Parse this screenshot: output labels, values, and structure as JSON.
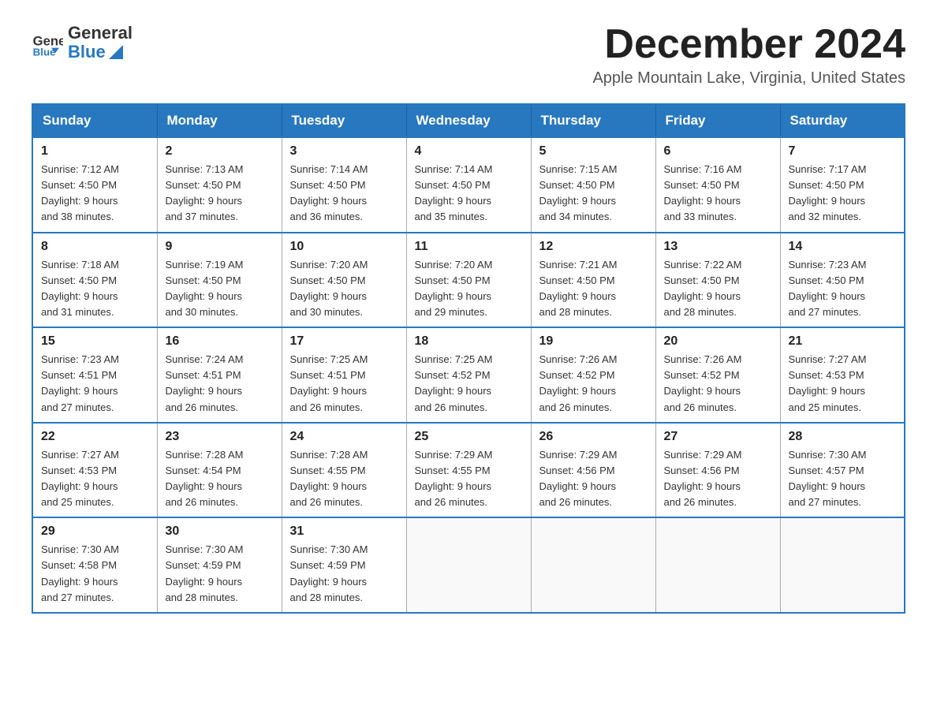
{
  "header": {
    "logo_text_general": "General",
    "logo_text_blue": "Blue",
    "month_title": "December 2024",
    "location": "Apple Mountain Lake, Virginia, United States"
  },
  "days_of_week": [
    "Sunday",
    "Monday",
    "Tuesday",
    "Wednesday",
    "Thursday",
    "Friday",
    "Saturday"
  ],
  "weeks": [
    [
      {
        "day": "1",
        "sunrise": "7:12 AM",
        "sunset": "4:50 PM",
        "daylight": "9 hours and 38 minutes."
      },
      {
        "day": "2",
        "sunrise": "7:13 AM",
        "sunset": "4:50 PM",
        "daylight": "9 hours and 37 minutes."
      },
      {
        "day": "3",
        "sunrise": "7:14 AM",
        "sunset": "4:50 PM",
        "daylight": "9 hours and 36 minutes."
      },
      {
        "day": "4",
        "sunrise": "7:14 AM",
        "sunset": "4:50 PM",
        "daylight": "9 hours and 35 minutes."
      },
      {
        "day": "5",
        "sunrise": "7:15 AM",
        "sunset": "4:50 PM",
        "daylight": "9 hours and 34 minutes."
      },
      {
        "day": "6",
        "sunrise": "7:16 AM",
        "sunset": "4:50 PM",
        "daylight": "9 hours and 33 minutes."
      },
      {
        "day": "7",
        "sunrise": "7:17 AM",
        "sunset": "4:50 PM",
        "daylight": "9 hours and 32 minutes."
      }
    ],
    [
      {
        "day": "8",
        "sunrise": "7:18 AM",
        "sunset": "4:50 PM",
        "daylight": "9 hours and 31 minutes."
      },
      {
        "day": "9",
        "sunrise": "7:19 AM",
        "sunset": "4:50 PM",
        "daylight": "9 hours and 30 minutes."
      },
      {
        "day": "10",
        "sunrise": "7:20 AM",
        "sunset": "4:50 PM",
        "daylight": "9 hours and 30 minutes."
      },
      {
        "day": "11",
        "sunrise": "7:20 AM",
        "sunset": "4:50 PM",
        "daylight": "9 hours and 29 minutes."
      },
      {
        "day": "12",
        "sunrise": "7:21 AM",
        "sunset": "4:50 PM",
        "daylight": "9 hours and 28 minutes."
      },
      {
        "day": "13",
        "sunrise": "7:22 AM",
        "sunset": "4:50 PM",
        "daylight": "9 hours and 28 minutes."
      },
      {
        "day": "14",
        "sunrise": "7:23 AM",
        "sunset": "4:50 PM",
        "daylight": "9 hours and 27 minutes."
      }
    ],
    [
      {
        "day": "15",
        "sunrise": "7:23 AM",
        "sunset": "4:51 PM",
        "daylight": "9 hours and 27 minutes."
      },
      {
        "day": "16",
        "sunrise": "7:24 AM",
        "sunset": "4:51 PM",
        "daylight": "9 hours and 26 minutes."
      },
      {
        "day": "17",
        "sunrise": "7:25 AM",
        "sunset": "4:51 PM",
        "daylight": "9 hours and 26 minutes."
      },
      {
        "day": "18",
        "sunrise": "7:25 AM",
        "sunset": "4:52 PM",
        "daylight": "9 hours and 26 minutes."
      },
      {
        "day": "19",
        "sunrise": "7:26 AM",
        "sunset": "4:52 PM",
        "daylight": "9 hours and 26 minutes."
      },
      {
        "day": "20",
        "sunrise": "7:26 AM",
        "sunset": "4:52 PM",
        "daylight": "9 hours and 26 minutes."
      },
      {
        "day": "21",
        "sunrise": "7:27 AM",
        "sunset": "4:53 PM",
        "daylight": "9 hours and 25 minutes."
      }
    ],
    [
      {
        "day": "22",
        "sunrise": "7:27 AM",
        "sunset": "4:53 PM",
        "daylight": "9 hours and 25 minutes."
      },
      {
        "day": "23",
        "sunrise": "7:28 AM",
        "sunset": "4:54 PM",
        "daylight": "9 hours and 26 minutes."
      },
      {
        "day": "24",
        "sunrise": "7:28 AM",
        "sunset": "4:55 PM",
        "daylight": "9 hours and 26 minutes."
      },
      {
        "day": "25",
        "sunrise": "7:29 AM",
        "sunset": "4:55 PM",
        "daylight": "9 hours and 26 minutes."
      },
      {
        "day": "26",
        "sunrise": "7:29 AM",
        "sunset": "4:56 PM",
        "daylight": "9 hours and 26 minutes."
      },
      {
        "day": "27",
        "sunrise": "7:29 AM",
        "sunset": "4:56 PM",
        "daylight": "9 hours and 26 minutes."
      },
      {
        "day": "28",
        "sunrise": "7:30 AM",
        "sunset": "4:57 PM",
        "daylight": "9 hours and 27 minutes."
      }
    ],
    [
      {
        "day": "29",
        "sunrise": "7:30 AM",
        "sunset": "4:58 PM",
        "daylight": "9 hours and 27 minutes."
      },
      {
        "day": "30",
        "sunrise": "7:30 AM",
        "sunset": "4:59 PM",
        "daylight": "9 hours and 28 minutes."
      },
      {
        "day": "31",
        "sunrise": "7:30 AM",
        "sunset": "4:59 PM",
        "daylight": "9 hours and 28 minutes."
      },
      null,
      null,
      null,
      null
    ]
  ],
  "labels": {
    "sunrise": "Sunrise:",
    "sunset": "Sunset:",
    "daylight": "Daylight: 9 hours"
  }
}
